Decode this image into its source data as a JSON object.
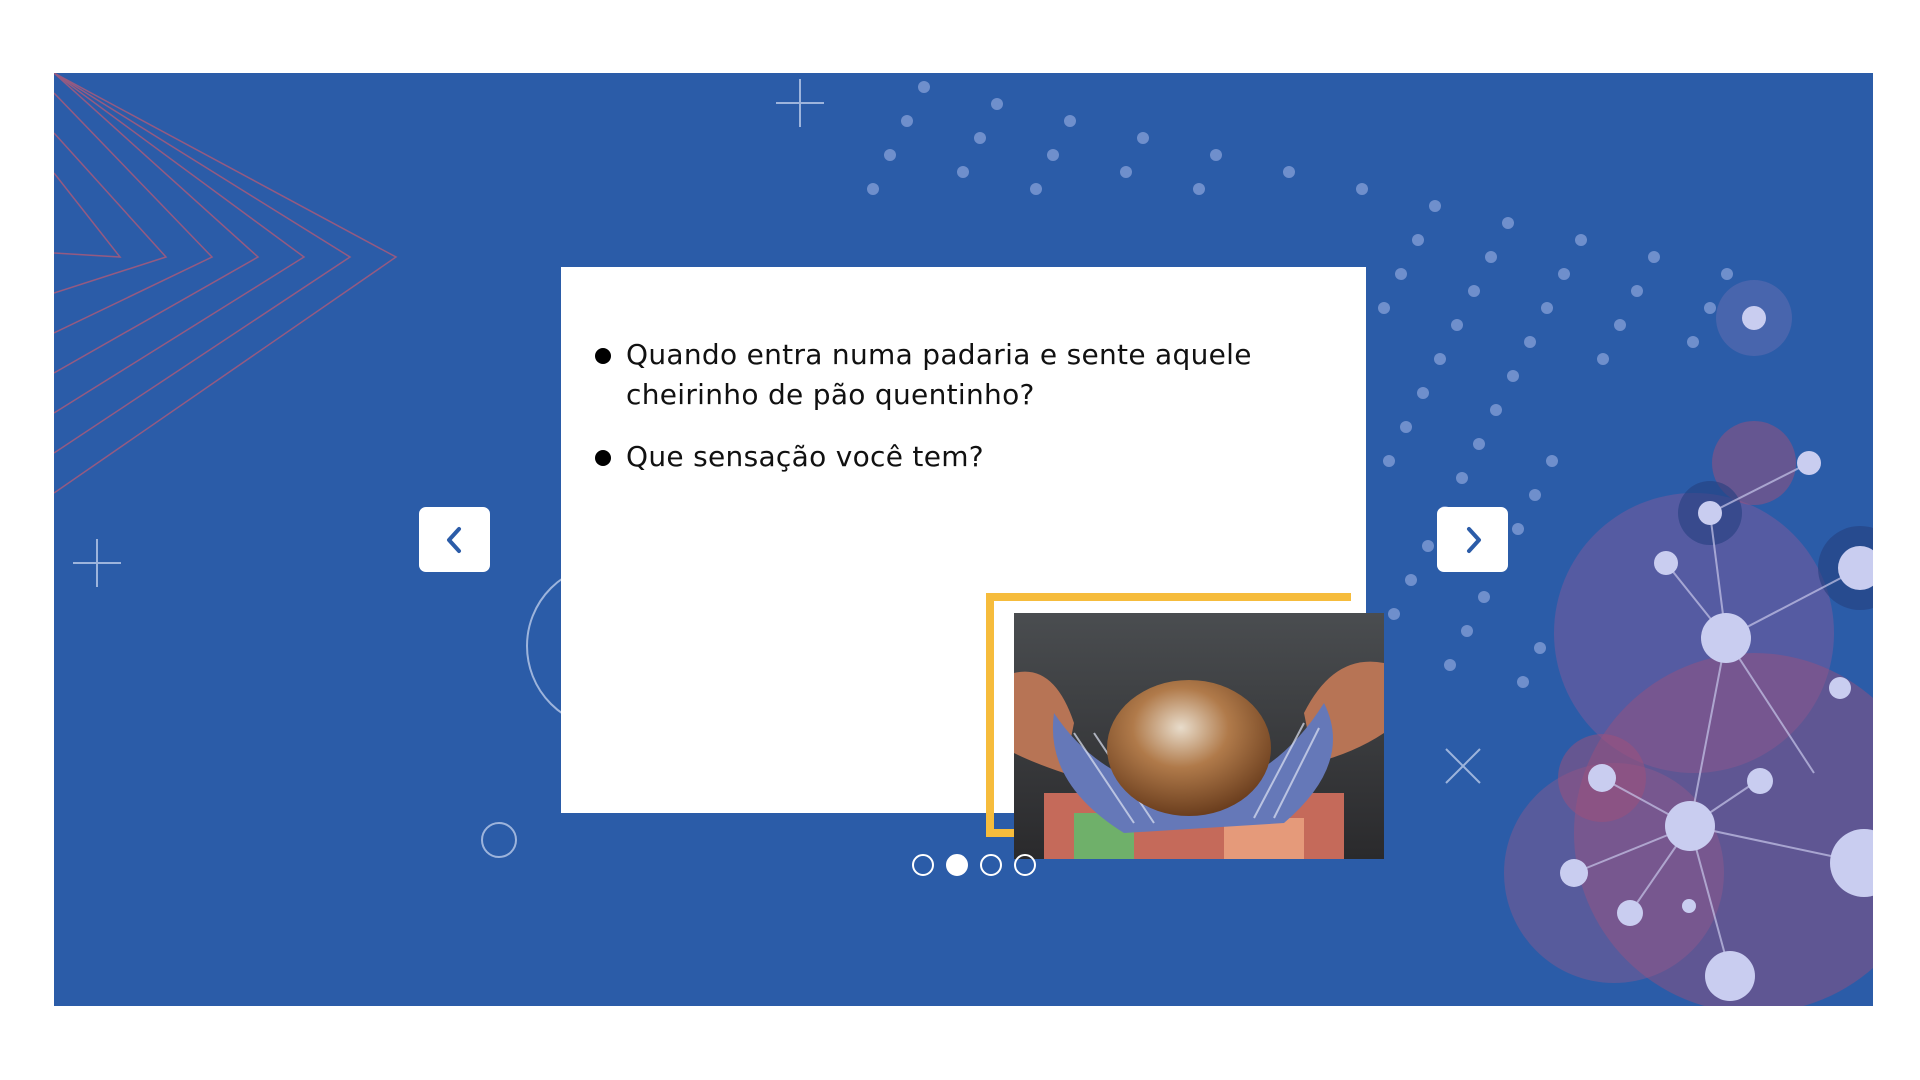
{
  "slide": {
    "bullets": [
      "Quando entra numa padaria e sente aquele cheirinho de pão quentinho?",
      "Que sensação você tem?"
    ],
    "image": "bread-loaf-in-hands-photo"
  },
  "navigation": {
    "prev_icon": "chevron-left-icon",
    "next_icon": "chevron-right-icon",
    "pages": 4,
    "current_page": 2
  },
  "colors": {
    "background": "#2b5ca8",
    "accent_frame": "#f6bc3c",
    "card": "#ffffff",
    "nav_arrow": "#2b5ca8"
  }
}
